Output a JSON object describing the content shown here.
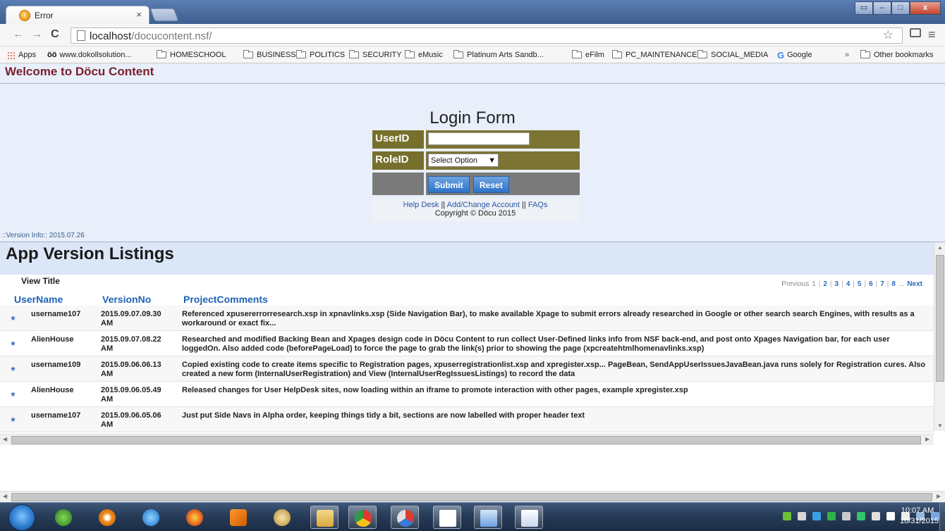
{
  "browser": {
    "tab_title": "Error",
    "tab_close": "×",
    "url_host": "localhost",
    "url_path": "/docucontent.nsf/",
    "back": "←",
    "forward": "→",
    "reload": "C",
    "star": "☆",
    "menu": "≡",
    "window_minimize": "–",
    "window_maximize": "□",
    "window_close": "x",
    "bookmarks": [
      {
        "label": "Apps",
        "icon": "apps-grid-icon"
      },
      {
        "label": "www.dokollsolution...",
        "icon": "dk-favicon-icon"
      },
      {
        "label": "HOMESCHOOL",
        "icon": "folder-icon"
      },
      {
        "label": "BUSINESS",
        "icon": "folder-icon"
      },
      {
        "label": "POLITICS",
        "icon": "folder-icon"
      },
      {
        "label": "SECURITY",
        "icon": "folder-icon"
      },
      {
        "label": "eMusic",
        "icon": "folder-icon"
      },
      {
        "label": "Platinum Arts Sandb...",
        "icon": "folder-icon"
      },
      {
        "label": "eFilm",
        "icon": "folder-icon"
      },
      {
        "label": "PC_MAINTENANCE",
        "icon": "folder-icon"
      },
      {
        "label": "SOCIAL_MEDIA",
        "icon": "folder-icon"
      },
      {
        "label": "Google",
        "icon": "google-icon"
      }
    ],
    "bookmarks_overflow": "»",
    "other_bookmarks": "Other bookmarks"
  },
  "page": {
    "welcome": "Welcome to Döcu Content",
    "login": {
      "title": "Login Form",
      "userid_label": "UserID",
      "userid_value": "",
      "roleid_label": "RoleID",
      "role_selected": "Select Option",
      "submit": "Submit",
      "reset": "Reset",
      "link_help": "Help Desk",
      "link_account": "Add/Change Account",
      "link_faqs": "FAQs",
      "separator": "||",
      "copyright": "Copyright © Döcu 2015"
    },
    "version_info": "::Version Info:: 2015.07.26",
    "listing": {
      "title": "App Version Listings",
      "view_title": "View Title",
      "pager": {
        "previous": "Previous",
        "pages": [
          "1",
          "2",
          "3",
          "4",
          "5",
          "6",
          "7",
          "8"
        ],
        "ellipsis": "...",
        "next": "Next"
      },
      "columns": [
        "UserName",
        "VersionNo",
        "ProjectComments"
      ],
      "rows": [
        {
          "user": "username107",
          "version": "2015.09.07.09.30 AM",
          "comment": "Referenced xpusererrorresearch.xsp in xpnavlinks.xsp (Side Navigation Bar), to make available Xpage to submit errors already researched in Google or other search search Engines, with results as a workaround or exact fix..."
        },
        {
          "user": "AlienHouse",
          "version": "2015.09.07.08.22 AM",
          "comment": "Researched and modified Backing Bean and Xpages design code in Döcu Content to run collect User-Defined links info from NSF back-end, and post onto Xpages Navigation bar, for each user loggedOn. Also added code (beforePageLoad) to force the page to grab the link(s) prior to showing the page (xpcreatehtmlhomenavlinks.xsp)"
        },
        {
          "user": "username109",
          "version": "2015.09.06.06.13 AM",
          "comment": "Copied existing code to create items specific to Registration pages, xpuserregistrationlist.xsp and xpregister.xsp... PageBean, SendAppUserIssuesJavaBean.java runs solely for Registration cures. Also created a new form (InternalUserRegistration) and View (InternalUserRegIssuesListings) to record the data"
        },
        {
          "user": "AlienHouse",
          "version": "2015.09.06.05.49 AM",
          "comment": "Released changes for User HelpDesk sites, now loading within an iframe to promote interaction with other pages, example xpregister.xsp"
        },
        {
          "user": "username107",
          "version": "2015.09.06.05.06 AM",
          "comment": "Just put Side Navs in Alpha order, keeping things tidy a bit, sections are now labelled with proper header text"
        }
      ]
    }
  },
  "taskbar": {
    "clock_time": "10:07 AM",
    "clock_date": "10/31/2015",
    "apps": [
      "lmms-icon",
      "blender-icon",
      "internet-explorer-icon",
      "firefox-icon",
      "media-player-icon",
      "paint-icon",
      "file-explorer-icon",
      "chrome-icon",
      "chrome-canary-icon",
      "notepad-icon",
      "word-icon",
      "office-icon"
    ]
  }
}
